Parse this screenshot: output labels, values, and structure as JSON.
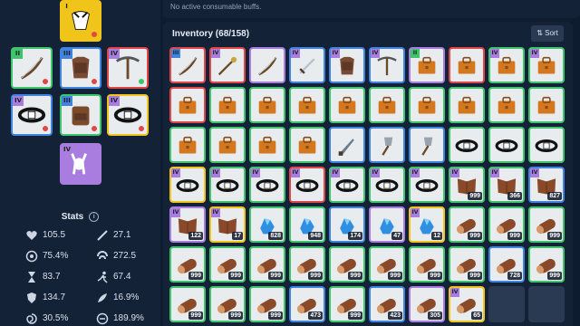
{
  "colors": {
    "I": "#f0c419",
    "II": "#3ec56b",
    "III": "#3f84e0",
    "IV": "#a97ddf",
    "R": "#e04848",
    "dot_red": "#e04848",
    "dot_green": "#3ec56b",
    "dot_orange": "#f0a020"
  },
  "equipment": [
    {
      "slot": "head",
      "tier": "I",
      "icon": "animal-head-icon",
      "rarity": "I",
      "dot": "red"
    },
    {
      "slot": "weapon",
      "tier": "II",
      "icon": "bow-icon",
      "rarity": "II",
      "dot": "red"
    },
    {
      "slot": "armor",
      "tier": "III",
      "icon": "armor-icon",
      "rarity": "III",
      "dot": "red"
    },
    {
      "slot": "tool",
      "tier": "IV",
      "icon": "pickaxe-icon",
      "rarity": "R",
      "dot": "green"
    },
    {
      "slot": "belt-left",
      "tier": "IV",
      "icon": "belt-icon",
      "rarity": "III",
      "dot": "red"
    },
    {
      "slot": "backpack",
      "tier": "III",
      "icon": "backpack-icon",
      "rarity": "II",
      "dot": "red"
    },
    {
      "slot": "belt-right",
      "tier": "IV",
      "icon": "belt-icon",
      "rarity": "I",
      "dot": "red"
    },
    {
      "slot": "mount",
      "tier": "IV",
      "icon": "donkey-icon",
      "rarity": "IV",
      "dot": ""
    }
  ],
  "stats": {
    "title": "Stats",
    "info": "i",
    "items": [
      {
        "icon": "heart-icon",
        "value": "105.5"
      },
      {
        "icon": "sword-icon",
        "value": "27.1"
      },
      {
        "icon": "percent-icon",
        "value": "75.4%"
      },
      {
        "icon": "crit-icon",
        "value": "272.5"
      },
      {
        "icon": "hourglass-icon",
        "value": "83.7"
      },
      {
        "icon": "running-icon",
        "value": "67.4"
      },
      {
        "icon": "shield-icon",
        "value": "134.7"
      },
      {
        "icon": "feather-icon",
        "value": "16.9%"
      },
      {
        "icon": "spiral-icon",
        "value": "30.5%"
      },
      {
        "icon": "lifesteal-icon",
        "value": "189.9%"
      }
    ]
  },
  "buffs": {
    "text": "No active consumable buffs."
  },
  "inventory": {
    "title": "Inventory",
    "count": "(68/158)",
    "sort_label": "⇅ Sort",
    "slots": [
      {
        "tier": "III",
        "rarity": "R",
        "icon": "bow-icon",
        "qty": ""
      },
      {
        "tier": "IV",
        "rarity": "R",
        "icon": "staff-icon",
        "qty": ""
      },
      {
        "tier": "",
        "rarity": "IV",
        "icon": "bow-icon",
        "qty": ""
      },
      {
        "tier": "IV",
        "rarity": "III",
        "icon": "sword-icon",
        "qty": ""
      },
      {
        "tier": "IV",
        "rarity": "III",
        "icon": "armor-icon",
        "qty": ""
      },
      {
        "tier": "IV",
        "rarity": "III",
        "icon": "pickaxe-icon",
        "qty": ""
      },
      {
        "tier": "II",
        "rarity": "IV",
        "icon": "bag-icon",
        "qty": ""
      },
      {
        "tier": "",
        "rarity": "R",
        "icon": "bag-icon",
        "qty": ""
      },
      {
        "tier": "IV",
        "rarity": "II",
        "icon": "bag-icon",
        "qty": ""
      },
      {
        "tier": "IV",
        "rarity": "II",
        "icon": "bag-icon",
        "qty": ""
      },
      {
        "tier": "",
        "rarity": "R",
        "icon": "bag-icon",
        "qty": ""
      },
      {
        "tier": "",
        "rarity": "II",
        "icon": "bag-icon",
        "qty": ""
      },
      {
        "tier": "",
        "rarity": "II",
        "icon": "bag-icon",
        "qty": ""
      },
      {
        "tier": "",
        "rarity": "II",
        "icon": "bag-icon",
        "qty": ""
      },
      {
        "tier": "",
        "rarity": "II",
        "icon": "bag-icon",
        "qty": ""
      },
      {
        "tier": "",
        "rarity": "II",
        "icon": "bag-icon",
        "qty": ""
      },
      {
        "tier": "",
        "rarity": "II",
        "icon": "bag-icon",
        "qty": ""
      },
      {
        "tier": "",
        "rarity": "II",
        "icon": "bag-icon",
        "qty": ""
      },
      {
        "tier": "",
        "rarity": "II",
        "icon": "bag-icon",
        "qty": ""
      },
      {
        "tier": "",
        "rarity": "II",
        "icon": "bag-icon",
        "qty": ""
      },
      {
        "tier": "",
        "rarity": "II",
        "icon": "bag-icon",
        "qty": ""
      },
      {
        "tier": "",
        "rarity": "II",
        "icon": "bag-icon",
        "qty": ""
      },
      {
        "tier": "",
        "rarity": "II",
        "icon": "bag-icon",
        "qty": ""
      },
      {
        "tier": "",
        "rarity": "II",
        "icon": "bag-icon",
        "qty": ""
      },
      {
        "tier": "",
        "rarity": "III",
        "icon": "knife-icon",
        "qty": ""
      },
      {
        "tier": "",
        "rarity": "III",
        "icon": "shovel-icon",
        "qty": ""
      },
      {
        "tier": "",
        "rarity": "III",
        "icon": "shovel-icon",
        "qty": ""
      },
      {
        "tier": "",
        "rarity": "II",
        "icon": "belt-icon",
        "qty": ""
      },
      {
        "tier": "",
        "rarity": "II",
        "icon": "belt-icon",
        "qty": ""
      },
      {
        "tier": "",
        "rarity": "II",
        "icon": "belt-icon",
        "qty": ""
      },
      {
        "tier": "IV",
        "rarity": "I",
        "icon": "belt-icon",
        "qty": ""
      },
      {
        "tier": "IV",
        "rarity": "II",
        "icon": "belt-icon",
        "qty": ""
      },
      {
        "tier": "IV",
        "rarity": "II",
        "icon": "belt-icon",
        "qty": ""
      },
      {
        "tier": "IV",
        "rarity": "R",
        "icon": "belt-icon",
        "qty": ""
      },
      {
        "tier": "IV",
        "rarity": "II",
        "icon": "belt-icon",
        "qty": ""
      },
      {
        "tier": "IV",
        "rarity": "II",
        "icon": "belt-icon",
        "qty": ""
      },
      {
        "tier": "IV",
        "rarity": "II",
        "icon": "belt-icon",
        "qty": ""
      },
      {
        "tier": "IV",
        "rarity": "II",
        "icon": "hide-icon",
        "qty": "999"
      },
      {
        "tier": "IV",
        "rarity": "II",
        "icon": "hide-icon",
        "qty": "366"
      },
      {
        "tier": "IV",
        "rarity": "III",
        "icon": "hide-icon",
        "qty": "827"
      },
      {
        "tier": "IV",
        "rarity": "IV",
        "icon": "hide-icon",
        "qty": "122"
      },
      {
        "tier": "IV",
        "rarity": "I",
        "icon": "hide-icon",
        "qty": "17"
      },
      {
        "tier": "",
        "rarity": "II",
        "icon": "ore-icon",
        "qty": "828"
      },
      {
        "tier": "",
        "rarity": "II",
        "icon": "ore-icon",
        "qty": "948"
      },
      {
        "tier": "",
        "rarity": "III",
        "icon": "ore-icon",
        "qty": "174"
      },
      {
        "tier": "",
        "rarity": "IV",
        "icon": "ore-icon",
        "qty": "47"
      },
      {
        "tier": "IV",
        "rarity": "I",
        "icon": "ore-icon",
        "qty": "12"
      },
      {
        "tier": "",
        "rarity": "II",
        "icon": "log-icon",
        "qty": "999"
      },
      {
        "tier": "",
        "rarity": "II",
        "icon": "log-icon",
        "qty": "999"
      },
      {
        "tier": "",
        "rarity": "II",
        "icon": "log-icon",
        "qty": "999"
      },
      {
        "tier": "",
        "rarity": "II",
        "icon": "log-icon",
        "qty": "999"
      },
      {
        "tier": "",
        "rarity": "II",
        "icon": "log-icon",
        "qty": "999"
      },
      {
        "tier": "",
        "rarity": "II",
        "icon": "log-icon",
        "qty": "999"
      },
      {
        "tier": "",
        "rarity": "II",
        "icon": "log-icon",
        "qty": "999"
      },
      {
        "tier": "",
        "rarity": "II",
        "icon": "log-icon",
        "qty": "999"
      },
      {
        "tier": "",
        "rarity": "II",
        "icon": "log-icon",
        "qty": "999"
      },
      {
        "tier": "",
        "rarity": "II",
        "icon": "log-icon",
        "qty": "999"
      },
      {
        "tier": "",
        "rarity": "II",
        "icon": "log-icon",
        "qty": "999"
      },
      {
        "tier": "",
        "rarity": "III",
        "icon": "log-icon",
        "qty": "728"
      },
      {
        "tier": "",
        "rarity": "II",
        "icon": "log-icon",
        "qty": "999"
      },
      {
        "tier": "",
        "rarity": "II",
        "icon": "log-icon",
        "qty": "999"
      },
      {
        "tier": "",
        "rarity": "II",
        "icon": "log-icon",
        "qty": "999"
      },
      {
        "tier": "",
        "rarity": "II",
        "icon": "log-icon",
        "qty": "999"
      },
      {
        "tier": "",
        "rarity": "III",
        "icon": "log-icon",
        "qty": "473"
      },
      {
        "tier": "",
        "rarity": "II",
        "icon": "log-icon",
        "qty": "999"
      },
      {
        "tier": "",
        "rarity": "III",
        "icon": "log-icon",
        "qty": "423"
      },
      {
        "tier": "",
        "rarity": "IV",
        "icon": "log-icon",
        "qty": "305"
      },
      {
        "tier": "IV",
        "rarity": "I",
        "icon": "log-icon",
        "qty": "65"
      },
      {
        "tier": "",
        "rarity": "empty",
        "icon": "",
        "qty": ""
      },
      {
        "tier": "",
        "rarity": "empty",
        "icon": "",
        "qty": ""
      }
    ]
  }
}
